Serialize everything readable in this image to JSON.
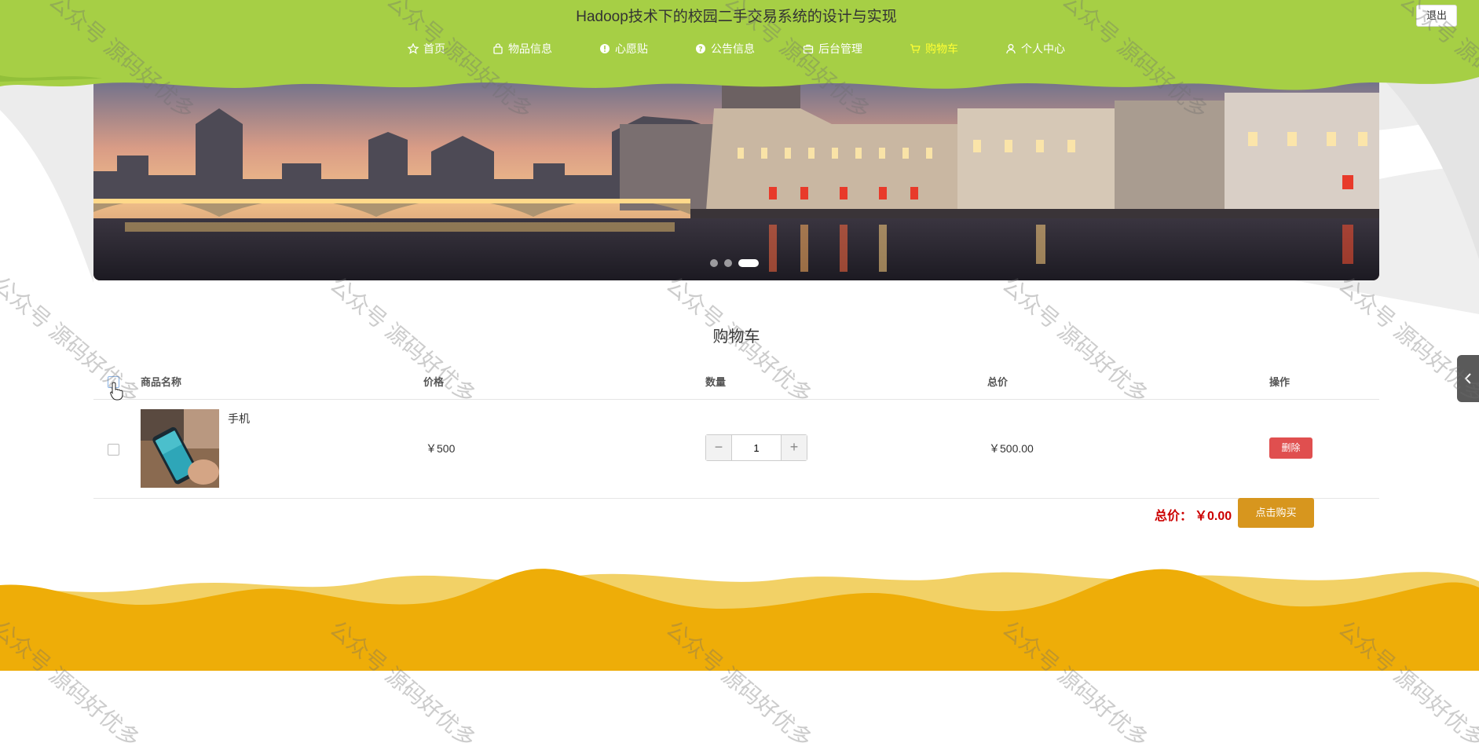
{
  "site": {
    "title": "Hadoop技术下的校园二手交易系统的设计与实现",
    "logout": "退出"
  },
  "nav": {
    "items": [
      {
        "label": "首页",
        "icon": "star-icon"
      },
      {
        "label": "物品信息",
        "icon": "bag-icon"
      },
      {
        "label": "心愿贴",
        "icon": "info-circle-icon"
      },
      {
        "label": "公告信息",
        "icon": "question-circle-icon"
      },
      {
        "label": "后台管理",
        "icon": "briefcase-icon"
      },
      {
        "label": "购物车",
        "icon": "cart-icon"
      },
      {
        "label": "个人中心",
        "icon": "user-icon"
      }
    ],
    "active": "购物车"
  },
  "carousel": {
    "slides": 3,
    "active_index": 3
  },
  "cart": {
    "title": "购物车",
    "columns": [
      "商品名称",
      "价格",
      "数量",
      "总价",
      "操作"
    ],
    "rows": [
      {
        "name": "手机",
        "price": "￥500",
        "quantity": "1",
        "total": "￥500.00",
        "action": "删除",
        "checked": false
      }
    ],
    "select_all_checked": false,
    "qty_minus": "−",
    "qty_plus": "+"
  },
  "summary": {
    "label": "总价：",
    "value": "￥0.00",
    "buy_button": "点击购买"
  },
  "watermark": {
    "text": "公众号 源码好优多"
  },
  "colors": {
    "header_green": "#a6cf45",
    "active_nav": "#ffff33",
    "delete_red": "#e04f4f",
    "buy_orange": "#d7961e",
    "total_red": "#cc0000",
    "footer_yellow": "#eead08"
  }
}
